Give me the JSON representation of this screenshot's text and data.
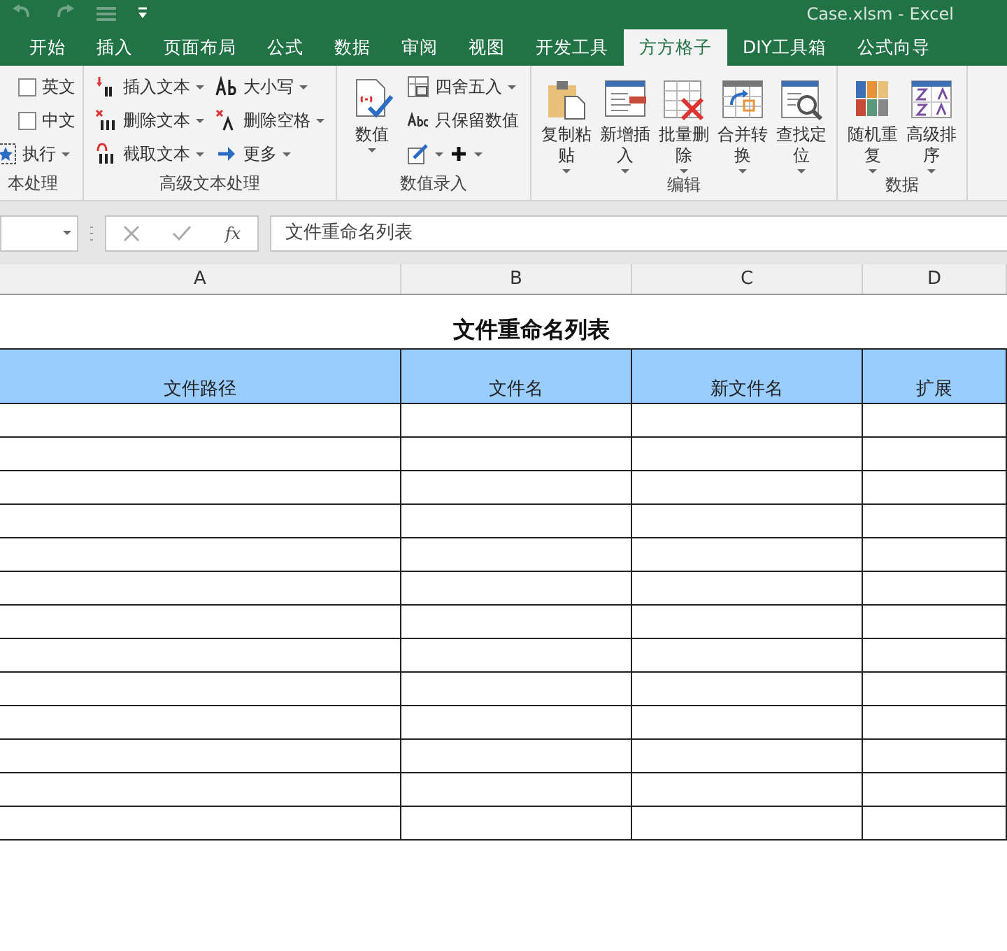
{
  "window": {
    "title": "Case.xlsm - Excel"
  },
  "tabs": [
    {
      "label": "开始",
      "selected": false
    },
    {
      "label": "插入",
      "selected": false
    },
    {
      "label": "页面布局",
      "selected": false
    },
    {
      "label": "公式",
      "selected": false
    },
    {
      "label": "数据",
      "selected": false
    },
    {
      "label": "审阅",
      "selected": false
    },
    {
      "label": "视图",
      "selected": false
    },
    {
      "label": "开发工具",
      "selected": false
    },
    {
      "label": "方方格子",
      "selected": true
    },
    {
      "label": "DIY工具箱",
      "selected": false
    },
    {
      "label": "公式向导",
      "selected": false
    }
  ],
  "ribbon": {
    "groups": [
      {
        "label": "本处理",
        "columns": [
          [
            {
              "kind": "checkbox",
              "label": "英文",
              "checked": false
            },
            {
              "kind": "checkbox",
              "label": "中文",
              "checked": false
            },
            {
              "kind": "small",
              "label": "执行",
              "dropdown": true
            }
          ]
        ]
      },
      {
        "label": "高级文本处理",
        "columns": [
          [
            {
              "kind": "small",
              "label": "插入文本",
              "dropdown": true
            },
            {
              "kind": "small",
              "label": "删除文本",
              "dropdown": true
            },
            {
              "kind": "small",
              "label": "截取文本",
              "dropdown": true
            }
          ],
          [
            {
              "kind": "small",
              "label": "大小写",
              "dropdown": true
            },
            {
              "kind": "small",
              "label": "删除空格",
              "dropdown": true
            },
            {
              "kind": "small",
              "label": "更多",
              "dropdown": true
            }
          ]
        ]
      },
      {
        "label": "数值录入",
        "columns": [
          [
            {
              "kind": "large",
              "label": "数值",
              "dropdown": true
            }
          ],
          [
            {
              "kind": "small",
              "label": "四舍五入",
              "dropdown": true
            },
            {
              "kind": "small",
              "label": "只保留数值",
              "dropdown": false
            },
            {
              "kind": "iconrow",
              "dropdown": true
            }
          ]
        ]
      },
      {
        "label": "编辑",
        "columns": [
          [
            {
              "kind": "large",
              "label": "复制粘贴",
              "dropdown": true
            }
          ],
          [
            {
              "kind": "large",
              "label": "新增插入",
              "dropdown": true
            }
          ],
          [
            {
              "kind": "large",
              "label": "批量删除",
              "dropdown": true
            }
          ],
          [
            {
              "kind": "large",
              "label": "合并转换",
              "dropdown": true
            }
          ],
          [
            {
              "kind": "large",
              "label": "查找定位",
              "dropdown": true
            }
          ]
        ]
      },
      {
        "label": "数据",
        "columns": [
          [
            {
              "kind": "large",
              "label": "随机重复",
              "dropdown": true
            }
          ],
          [
            {
              "kind": "large",
              "label": "高级排序",
              "dropdown": true
            }
          ]
        ]
      }
    ]
  },
  "formula_bar": {
    "function_label": "fx",
    "value": "文件重命名列表"
  },
  "sheet": {
    "columns": [
      "A",
      "B",
      "C",
      "D"
    ],
    "title": "文件重命名列表",
    "headers": [
      "文件路径",
      "文件名",
      "新文件名",
      "扩展"
    ]
  }
}
